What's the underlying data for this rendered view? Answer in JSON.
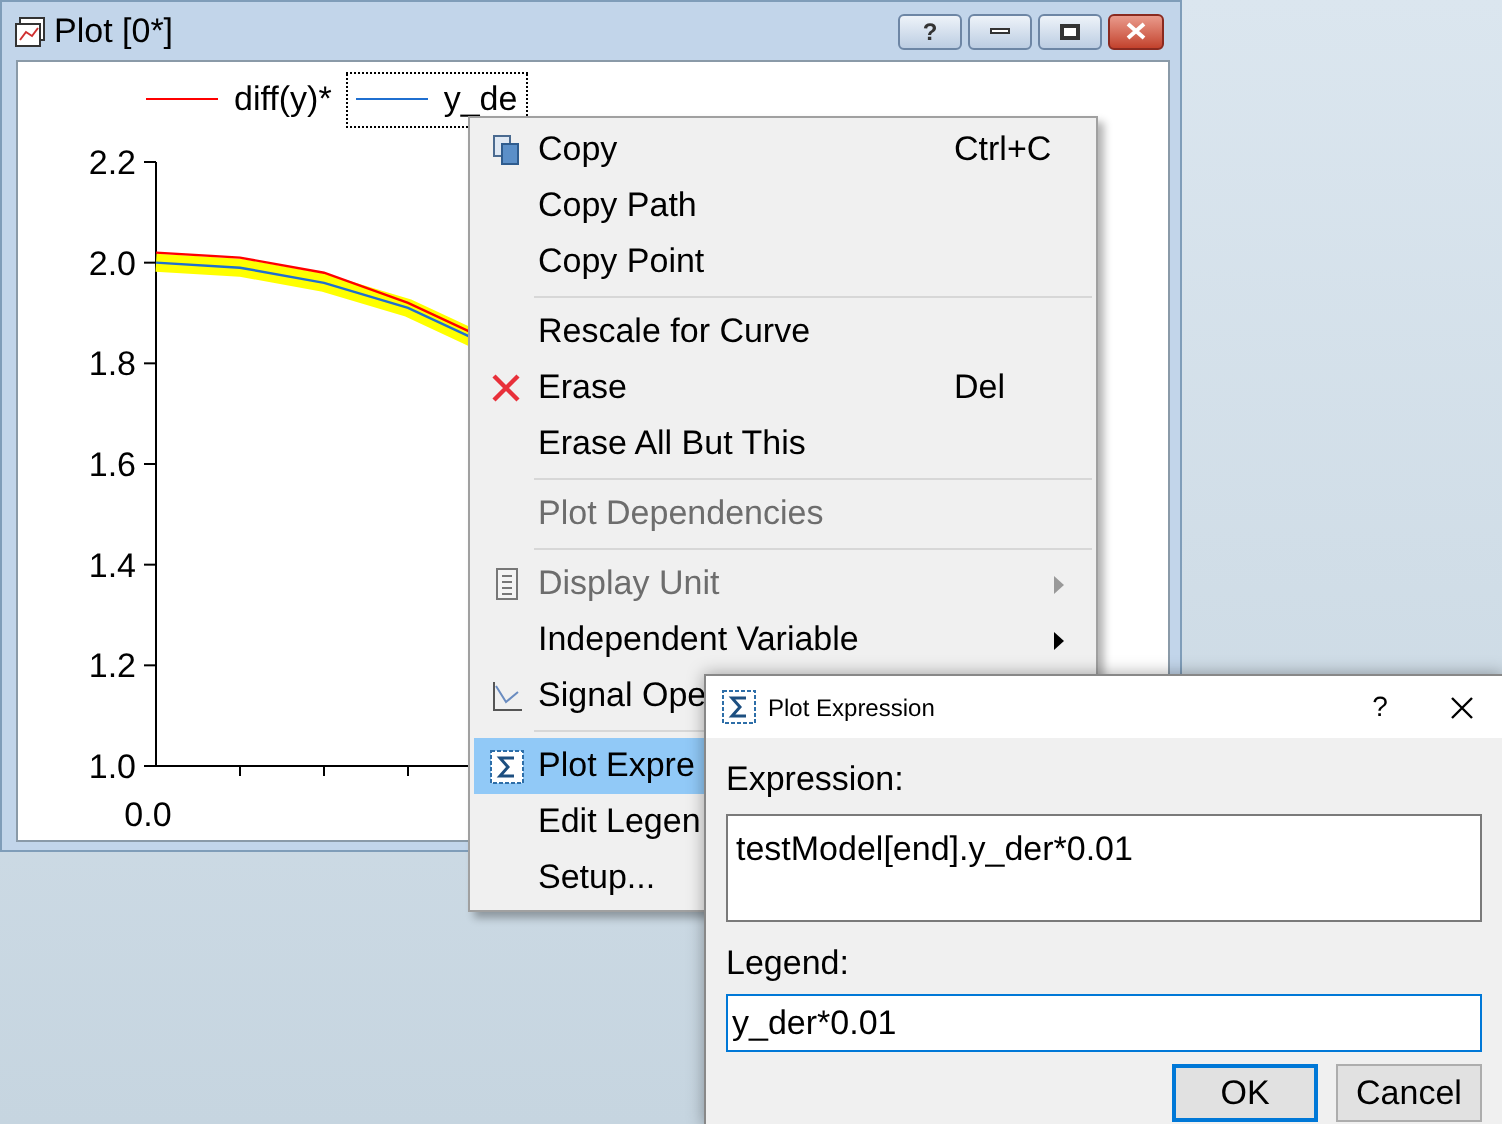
{
  "plot_window": {
    "title": "Plot [0*]",
    "buttons": [
      "?"
    ]
  },
  "plot": {
    "legend": [
      {
        "name": "diff(y)*",
        "color": "#ff0000",
        "selected": false
      },
      {
        "name": "y_de",
        "color": "#1f6fd0",
        "selected": true
      }
    ],
    "y_ticks": [
      "2.2",
      "2.0",
      "1.8",
      "1.6",
      "1.4",
      "1.2",
      "1.0"
    ],
    "x_tick": "0.0"
  },
  "context_menu": {
    "items": [
      {
        "kind": "item",
        "label": "Copy",
        "shortcut": "Ctrl+C",
        "disabled": false,
        "selected": false,
        "submenu": false
      },
      {
        "kind": "item",
        "label": "Copy Path",
        "disabled": false,
        "selected": false,
        "submenu": false
      },
      {
        "kind": "item",
        "label": "Copy Point",
        "disabled": false,
        "selected": false,
        "submenu": false
      },
      {
        "kind": "separator"
      },
      {
        "kind": "item",
        "label": "Rescale for Curve",
        "disabled": false,
        "selected": false,
        "submenu": false
      },
      {
        "kind": "item",
        "label": "Erase",
        "shortcut": "Del",
        "disabled": false,
        "selected": false,
        "submenu": false
      },
      {
        "kind": "item",
        "label": "Erase All But This",
        "disabled": false,
        "selected": false,
        "submenu": false
      },
      {
        "kind": "separator"
      },
      {
        "kind": "item",
        "label": "Plot Dependencies",
        "disabled": true,
        "selected": false,
        "submenu": false
      },
      {
        "kind": "separator"
      },
      {
        "kind": "item",
        "label": "Display Unit",
        "disabled": true,
        "selected": false,
        "submenu": true
      },
      {
        "kind": "item",
        "label": "Independent Variable",
        "disabled": false,
        "selected": false,
        "submenu": true
      },
      {
        "kind": "item",
        "label": "Signal Ope",
        "disabled": false,
        "selected": false,
        "submenu": false
      },
      {
        "kind": "separator"
      },
      {
        "kind": "item",
        "label": "Plot Expre",
        "disabled": false,
        "selected": true,
        "submenu": false
      },
      {
        "kind": "item",
        "label": "Edit Legen",
        "disabled": false,
        "selected": false,
        "submenu": false
      },
      {
        "kind": "item",
        "label": "Setup...",
        "disabled": false,
        "selected": false,
        "submenu": false
      }
    ]
  },
  "dialog": {
    "title": "Plot Expression",
    "help": "?",
    "expression_label": "Expression:",
    "expression": "testModel[end].y_der*0.01",
    "legend_label": "Legend:",
    "legend": "y_der*0.01",
    "buttons": [
      "OK",
      "Cancel"
    ]
  }
}
